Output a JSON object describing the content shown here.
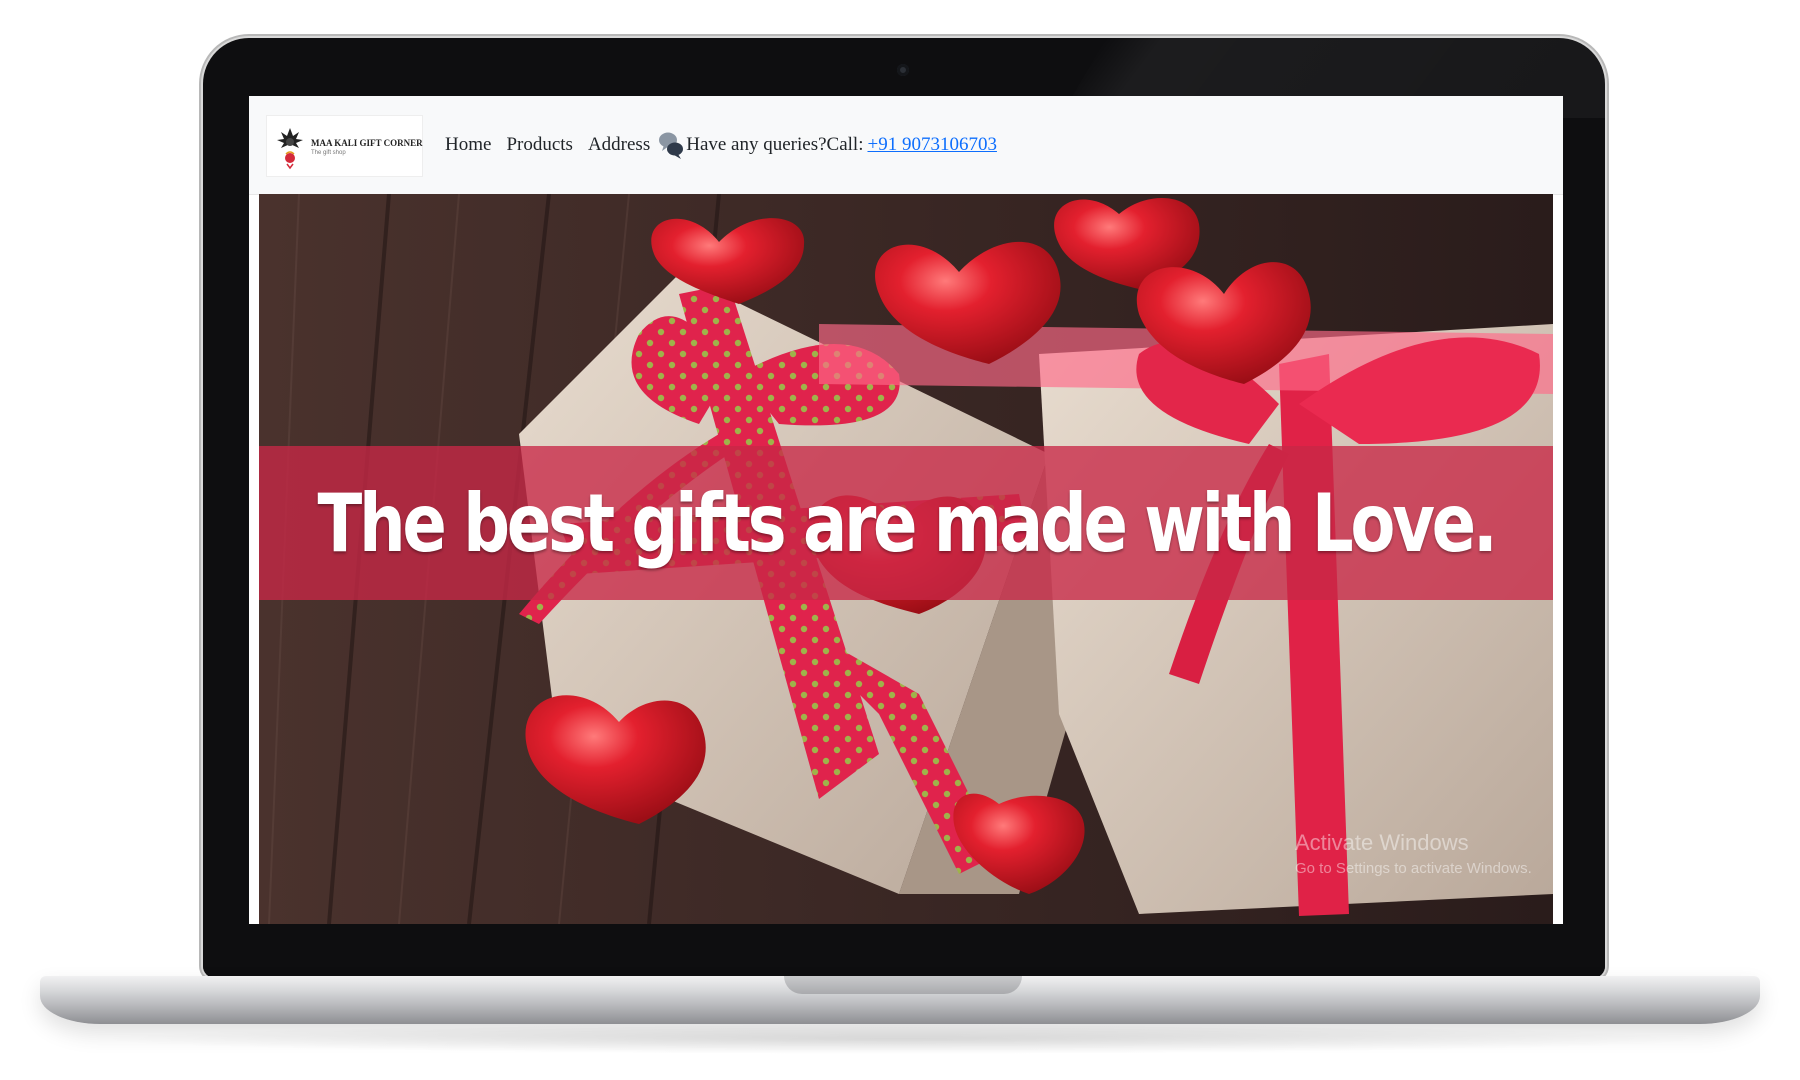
{
  "brand": {
    "name": "MAA KALI GIFT CORNER",
    "tagline": "The gift shop"
  },
  "nav": {
    "links": [
      {
        "label": "Home"
      },
      {
        "label": "Products"
      },
      {
        "label": "Address"
      }
    ],
    "queries_text": "Have any queries?Call:",
    "phone": "+91 9073106703",
    "icon": "chat-bubbles-icon"
  },
  "hero": {
    "headline": "The best gifts are made with Love.",
    "band_color": "#c8284680"
  },
  "watermark": {
    "title": "Activate Windows",
    "subtitle": "Go to Settings to activate Windows."
  },
  "colors": {
    "navbar_bg": "#f8f9fa",
    "link": "#0d6efd",
    "ribbon": "#e8254e",
    "heart": "#e3202e",
    "wood": "#3b2a28"
  }
}
